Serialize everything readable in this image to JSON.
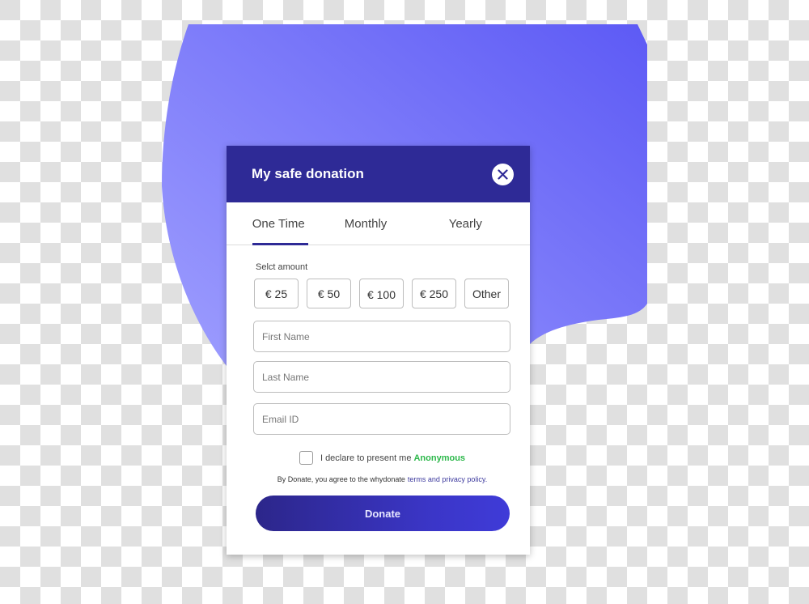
{
  "colors": {
    "header_bg": "#2e2a96",
    "accent": "#2e2a96",
    "anonymous_green": "#2db84b",
    "link": "#3d3a9e",
    "blob_top": "#5d5af5",
    "blob_bottom": "#9c9cff"
  },
  "dialog": {
    "title": "My safe donation",
    "close_icon": "close-icon"
  },
  "tabs": [
    {
      "label": "One Time",
      "active": true
    },
    {
      "label": "Monthly",
      "active": false
    },
    {
      "label": "Yearly",
      "active": false
    }
  ],
  "amount": {
    "label": "Selct amount",
    "options": [
      "€ 25",
      "€ 50",
      "€ 100",
      "€ 250",
      "Other"
    ]
  },
  "fields": {
    "first_name_placeholder": "First Name",
    "last_name_placeholder": "Last Name",
    "email_placeholder": "Email ID"
  },
  "declare": {
    "checked": false,
    "text": "I declare to present me",
    "highlight": "Anonymous"
  },
  "terms": {
    "prefix": "By Donate, you agree to the whydonate",
    "link": "terms and privacy policy."
  },
  "donate_button": "Donate"
}
